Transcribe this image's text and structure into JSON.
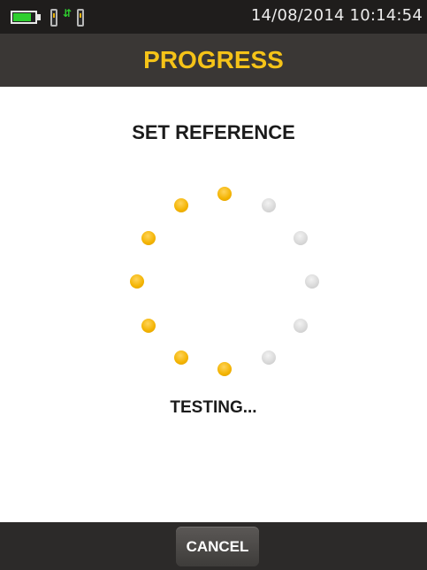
{
  "status_bar": {
    "datetime": "14/08/2014 10:14:54",
    "battery_level": 0.85,
    "icons": [
      "battery-icon",
      "module-icon",
      "link-arrows-icon",
      "module-icon"
    ]
  },
  "header": {
    "title": "PROGRESS"
  },
  "main": {
    "heading": "SET REFERENCE",
    "spinner": {
      "total_dots": 12,
      "active_dots": 7
    },
    "status": "TESTING..."
  },
  "footer": {
    "cancel_label": "CANCEL"
  },
  "colors": {
    "accent": "#f5c318",
    "dot_active": "#f3b300",
    "dot_inactive": "#d6d6d6",
    "title_bar": "#3a3735",
    "status_bar": "#1f1d1c",
    "battery": "#2fcf2f"
  }
}
